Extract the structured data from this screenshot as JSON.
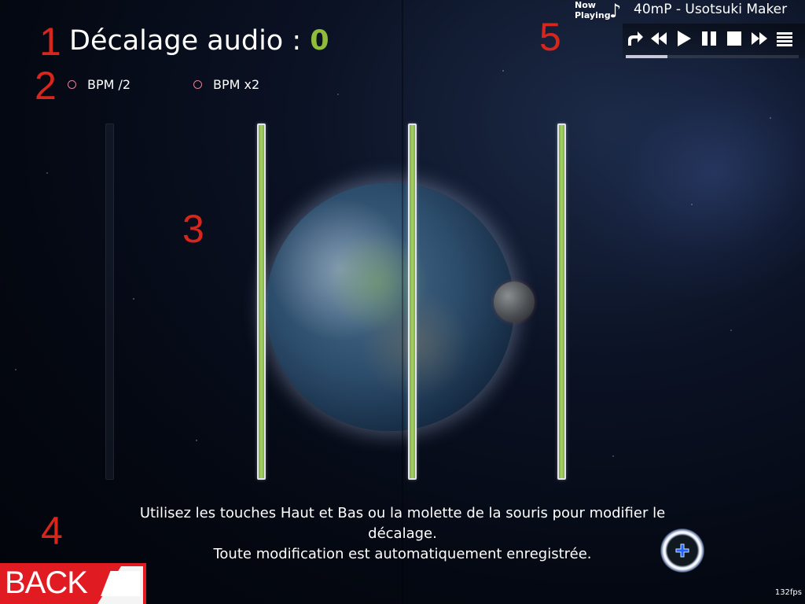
{
  "offset": {
    "label": "Décalage audio :",
    "value": "0"
  },
  "bpm_options": [
    {
      "label": "BPM /2"
    },
    {
      "label": "BPM x2"
    }
  ],
  "markers": [
    "1",
    "2",
    "3",
    "4",
    "5"
  ],
  "hint": {
    "line1": "Utilisez les touches Haut et Bas ou la molette de la souris pour modifier le décalage.",
    "line2": "Toute modification est automatiquement enregistrée."
  },
  "back": {
    "label": "BACK"
  },
  "now_playing": {
    "label_line1": "Now",
    "label_line2": "Playing",
    "note": "♪",
    "title": "40mP - Usotsuki Maker",
    "progress": 0.24
  },
  "controls": [
    "loop-icon",
    "previous-icon",
    "play-icon",
    "pause-icon",
    "stop-icon",
    "next-icon",
    "playlist-icon"
  ],
  "fps": "132fps",
  "colors": {
    "accent_green": "#8fbc3a",
    "back_red": "#e11b22",
    "marker_red": "#d9261c",
    "radio_pink": "#e87d95"
  }
}
